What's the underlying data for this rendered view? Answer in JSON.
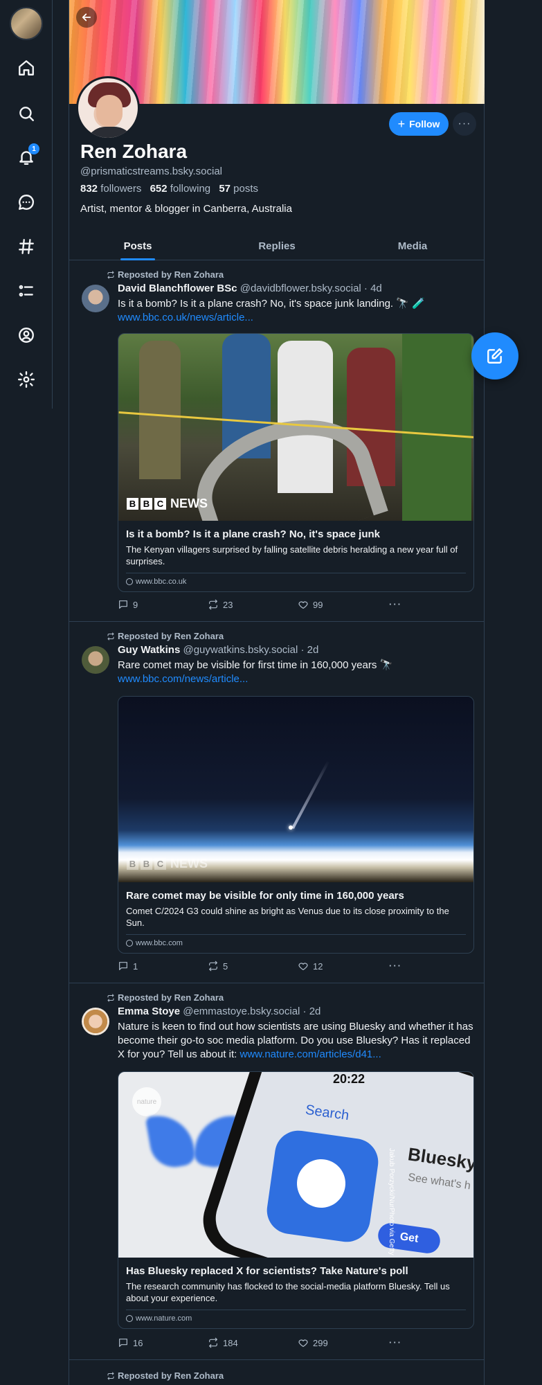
{
  "profile": {
    "display_name": "Ren Zohara",
    "handle": "@prismaticstreams.bsky.social",
    "followers_count": "832",
    "followers_label": "followers",
    "following_count": "652",
    "following_label": "following",
    "posts_count": "57",
    "posts_label": "posts",
    "bio": "Artist, mentor & blogger in Canberra, Australia",
    "follow_label": "Follow",
    "more_label": "···"
  },
  "nav": {
    "notification_badge": "1",
    "icons": [
      "home-icon",
      "search-icon",
      "bell-icon",
      "chat-icon",
      "hashtag-icon",
      "list-icon",
      "profile-icon",
      "gear-icon"
    ]
  },
  "tabs": [
    {
      "label": "Posts",
      "active": true
    },
    {
      "label": "Replies",
      "active": false
    },
    {
      "label": "Media",
      "active": false
    }
  ],
  "posts": [
    {
      "repost_label": "Reposted by Ren Zohara",
      "author_name": "David Blanchflower BSc",
      "author_meta": "@davidbflower.bsky.social · 4d",
      "text": "Is it a bomb? Is it a plane crash? No, it's space junk landing. 🔭 🧪",
      "link": "www.bbc.co.uk/news/article...",
      "card_title": "Is it a bomb? Is it a plane crash? No, it's space junk",
      "card_desc": "The Kenyan villagers surprised by falling satellite debris heralding a new year full of surprises.",
      "card_domain": "www.bbc.co.uk",
      "image_brand": "NEWS",
      "replies": "9",
      "reposts": "23",
      "likes": "99"
    },
    {
      "repost_label": "Reposted by Ren Zohara",
      "author_name": "Guy Watkins",
      "author_meta": "@guywatkins.bsky.social · 2d",
      "text": "Rare comet may be visible for first time in 160,000 years 🔭",
      "link": "www.bbc.com/news/article...",
      "card_title": "Rare comet may be visible for only time in 160,000 years",
      "card_desc": "Comet C/2024 G3 could shine as bright as Venus due to its close proximity to the Sun.",
      "card_domain": "www.bbc.com",
      "image_brand": "NEWS",
      "replies": "1",
      "reposts": "5",
      "likes": "12"
    },
    {
      "repost_label": "Reposted by Ren Zohara",
      "author_name": "Emma Stoye",
      "author_meta": "@emmastoye.bsky.social · 2d",
      "text": "Nature is keen to find out how scientists are using Bluesky and whether it has become their go-to soc media platform. Do you use Bluesky? Has it replaced X for you? Tell us about it: ",
      "link": "www.nature.com/articles/d41...",
      "card_title": "Has Bluesky replaced X for scientists? Take Nature's poll",
      "card_desc": "The research community has flocked to the social-media platform Bluesky. Tell us about your experience.",
      "card_domain": "www.nature.com",
      "image_time": "20:22",
      "image_search": "Search",
      "image_app": "Bluesky",
      "image_sub": "See what's h",
      "image_get": "Get",
      "image_credit": "Jakub Porzycki/NurPhoto via Getty",
      "image_badge": "nature",
      "replies": "16",
      "reposts": "184",
      "likes": "299"
    },
    {
      "repost_label": "Reposted by Ren Zohara"
    }
  ]
}
